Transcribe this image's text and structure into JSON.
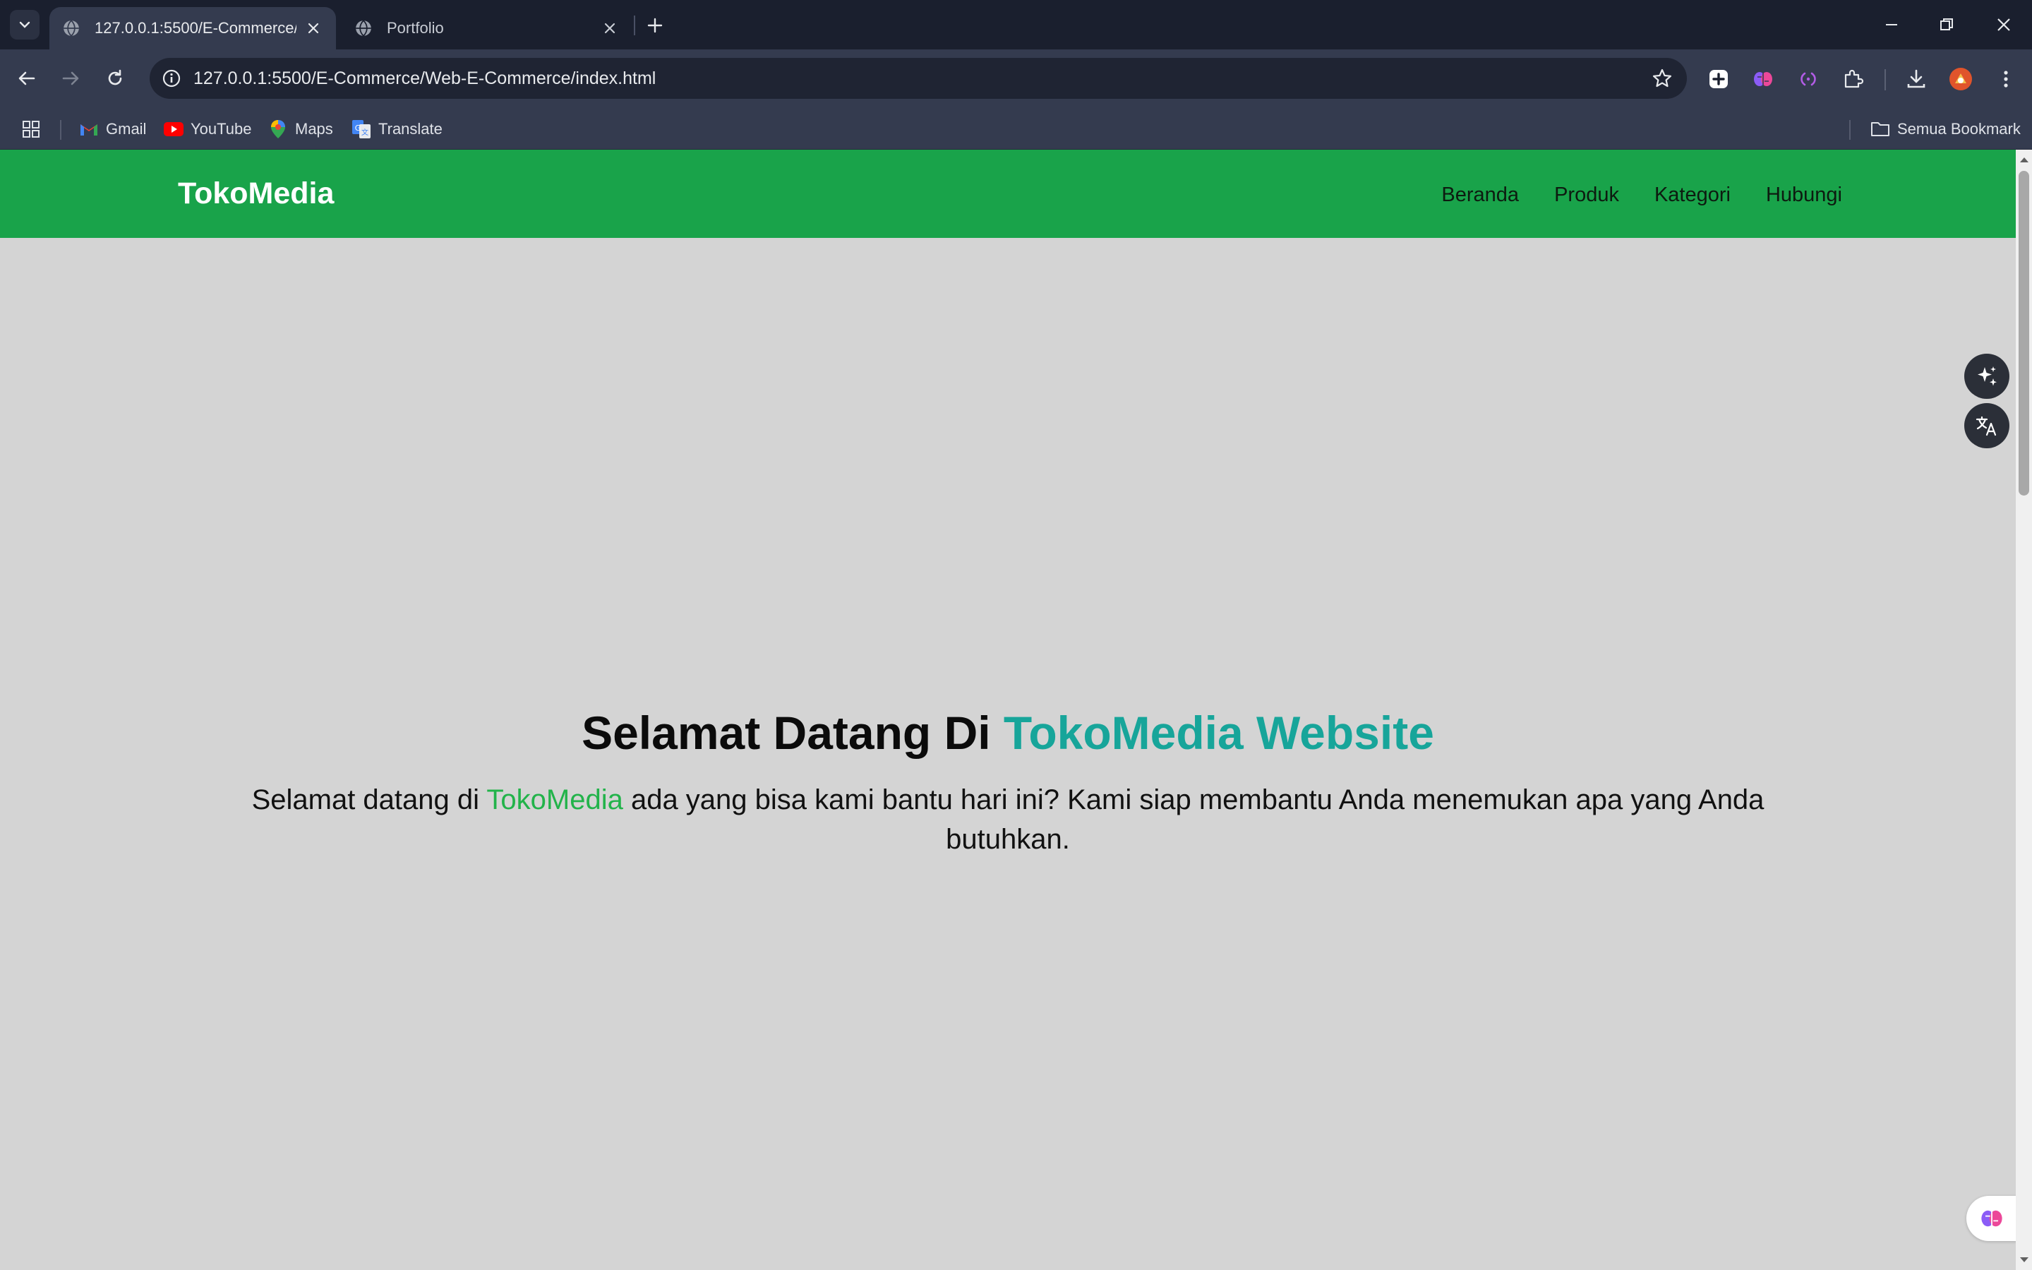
{
  "browser": {
    "tabs": [
      {
        "title": "127.0.0.1:5500/E-Commerce/Web-E-Commerce/index.html",
        "active": true
      },
      {
        "title": "Portfolio",
        "active": false
      }
    ],
    "url": "127.0.0.1:5500/E-Commerce/Web-E-Commerce/index.html",
    "bookmarks": [
      {
        "label": "Gmail",
        "icon": "gmail-icon"
      },
      {
        "label": "YouTube",
        "icon": "youtube-icon"
      },
      {
        "label": "Maps",
        "icon": "maps-icon"
      },
      {
        "label": "Translate",
        "icon": "translate-icon"
      }
    ],
    "all_bookmarks_label": "Semua Bookmark"
  },
  "site": {
    "brand": "TokoMedia",
    "nav": [
      "Beranda",
      "Produk",
      "Kategori",
      "Hubungi"
    ],
    "hero": {
      "title_prefix": "Selamat Datang Di ",
      "title_highlight": "TokoMedia Website",
      "text_prefix": "Selamat datang di ",
      "text_highlight": "TokoMedia",
      "text_suffix": " ada yang bisa kami bantu hari ini? Kami siap membantu Anda menemukan apa yang Anda butuhkan."
    }
  },
  "colors": {
    "nav_bg": "#19a34a",
    "page_bg": "#d4d4d4",
    "title_highlight": "#17a59a",
    "text_highlight": "#22b34a",
    "chrome_dark": "#1a1f2e",
    "chrome_toolbar": "#343b4f"
  }
}
